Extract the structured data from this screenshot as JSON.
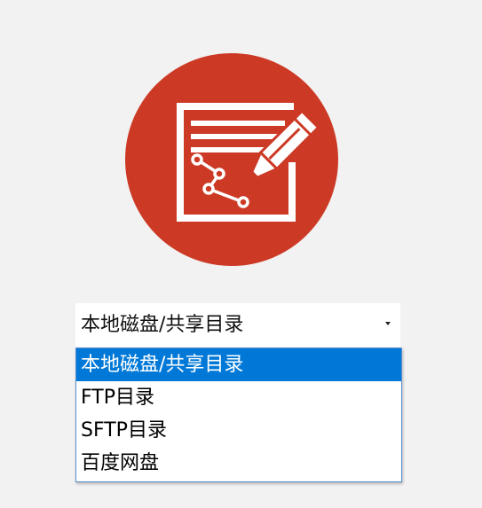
{
  "logo": {
    "icon": "note-edit-icon",
    "background_color": "#cc3a26",
    "foreground_color": "#ffffff"
  },
  "select": {
    "value": "本地磁盘/共享目录",
    "icon": "dropdown-arrow-icon",
    "options": [
      {
        "label": "本地磁盘/共享目录",
        "selected": true
      },
      {
        "label": "FTP目录",
        "selected": false
      },
      {
        "label": "SFTP目录",
        "selected": false
      },
      {
        "label": "百度网盘",
        "selected": false
      }
    ],
    "highlight_color": "#0078d7"
  }
}
